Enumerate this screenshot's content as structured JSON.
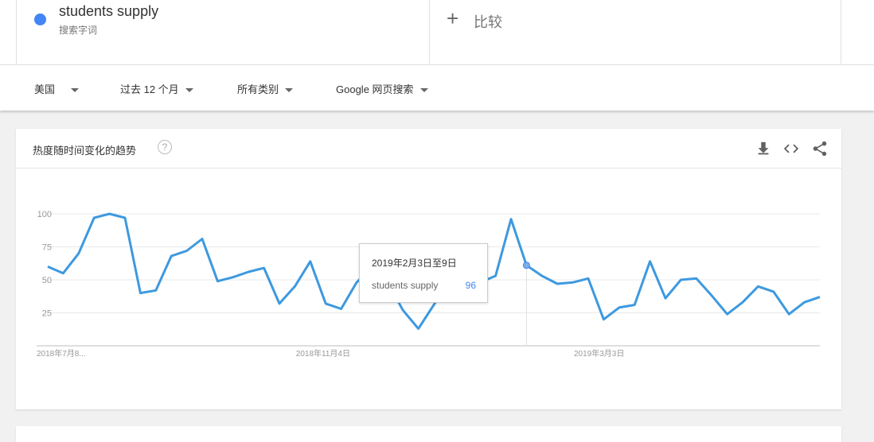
{
  "term": {
    "name": "students supply",
    "subtitle": "搜索字词",
    "color": "#4285f4"
  },
  "compare": {
    "label": "比较",
    "icon": "plus-icon"
  },
  "filters": {
    "region": "美国",
    "time": "过去 12 个月",
    "category": "所有类别",
    "source": "Google 网页搜索"
  },
  "card": {
    "title": "热度随时间变化的趋势",
    "help_icon": "question-circle-icon",
    "tools": [
      "download-icon",
      "embed-icon",
      "share-icon"
    ]
  },
  "tooltip": {
    "date": "2019年2月3日至9日",
    "term": "students supply",
    "value": "96"
  },
  "chart_data": {
    "type": "line",
    "ylim": [
      0,
      100
    ],
    "yticks": [
      25,
      50,
      75,
      100
    ],
    "xtick_labels": [
      "2018年7月8...",
      "2018年11月4日",
      "2019年3月3日"
    ],
    "xtick_indices": [
      0,
      17,
      35
    ],
    "highlight_index": 31,
    "grid": true,
    "series": [
      {
        "name": "students supply",
        "color": "#3d99df",
        "values": [
          60,
          55,
          70,
          97,
          100,
          97,
          40,
          42,
          68,
          72,
          81,
          49,
          52,
          56,
          59,
          32,
          45,
          64,
          32,
          28,
          48,
          60,
          48,
          27,
          13,
          31,
          49,
          41,
          48,
          53,
          96,
          61,
          53,
          47,
          48,
          51,
          20,
          29,
          31,
          64,
          36,
          50,
          51,
          38,
          24,
          33,
          45,
          41,
          24,
          33,
          37
        ]
      }
    ]
  }
}
